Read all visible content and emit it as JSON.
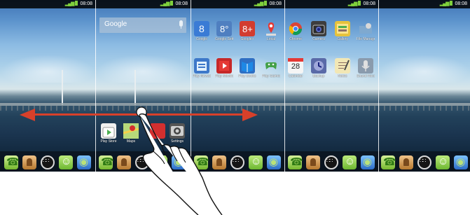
{
  "screen_time": "08:08",
  "panels": [
    {
      "id": "home-panel-1"
    },
    {
      "id": "home-panel-2"
    },
    {
      "id": "home-panel-3"
    },
    {
      "id": "home-panel-4"
    },
    {
      "id": "home-panel-5"
    }
  ],
  "google_widget": {
    "label": "Google"
  },
  "home_apps": [
    {
      "label": "Play Store",
      "icon": "play-store-icon",
      "color": "#f0f0f0"
    },
    {
      "label": "Maps",
      "icon": "maps-icon",
      "color": "#8bc34a"
    },
    {
      "label": "",
      "icon": "red-app-icon",
      "color": "#d32f2f"
    },
    {
      "label": "Settings",
      "icon": "settings-icon",
      "color": "#555555"
    }
  ],
  "apps_row1": [
    {
      "label": "Google",
      "icon": "google-search-icon",
      "color": "#3a7bd5"
    },
    {
      "label": "Google Sett",
      "icon": "google-settings-icon",
      "color": "#4f7fc0"
    },
    {
      "label": "Google+",
      "icon": "google-plus-icon",
      "color": "#d23c2f"
    },
    {
      "label": "Local",
      "icon": "local-icon",
      "color": "#f4f4f4"
    },
    {
      "label": "Chrome",
      "icon": "chrome-icon",
      "color": "#e8e8e8"
    },
    {
      "label": "Camera",
      "icon": "camera-icon",
      "color": "#3d3d3d"
    },
    {
      "label": "Gallery",
      "icon": "gallery-icon",
      "color": "#e6c23b"
    },
    {
      "label": "File Manage",
      "icon": "file-manager-icon",
      "color": "#a8c7e0"
    }
  ],
  "apps_row2": [
    {
      "label": "Play Newsst",
      "icon": "play-newsstand-icon",
      "color": "#3d78c9"
    },
    {
      "label": "Play Movies",
      "icon": "play-movies-icon",
      "color": "#c62828"
    },
    {
      "label": "Play Books",
      "icon": "play-books-icon",
      "color": "#2f6fc3"
    },
    {
      "label": "Play Games",
      "icon": "play-games-icon",
      "color": "#4caf50"
    },
    {
      "label": "Calendar",
      "icon": "calendar-icon",
      "color": "#f5f5f5",
      "badge": "28"
    },
    {
      "label": "Backup",
      "icon": "backup-icon",
      "color": "#5a6aa8"
    },
    {
      "label": "Notes",
      "icon": "notes-icon",
      "color": "#f2e7b5"
    },
    {
      "label": "Sound Reco",
      "icon": "sound-recorder-icon",
      "color": "#8a9bad"
    }
  ],
  "dock_icons": [
    "phone-icon",
    "contacts-icon",
    "apps-drawer-icon",
    "messaging-icon",
    "browser-icon"
  ]
}
